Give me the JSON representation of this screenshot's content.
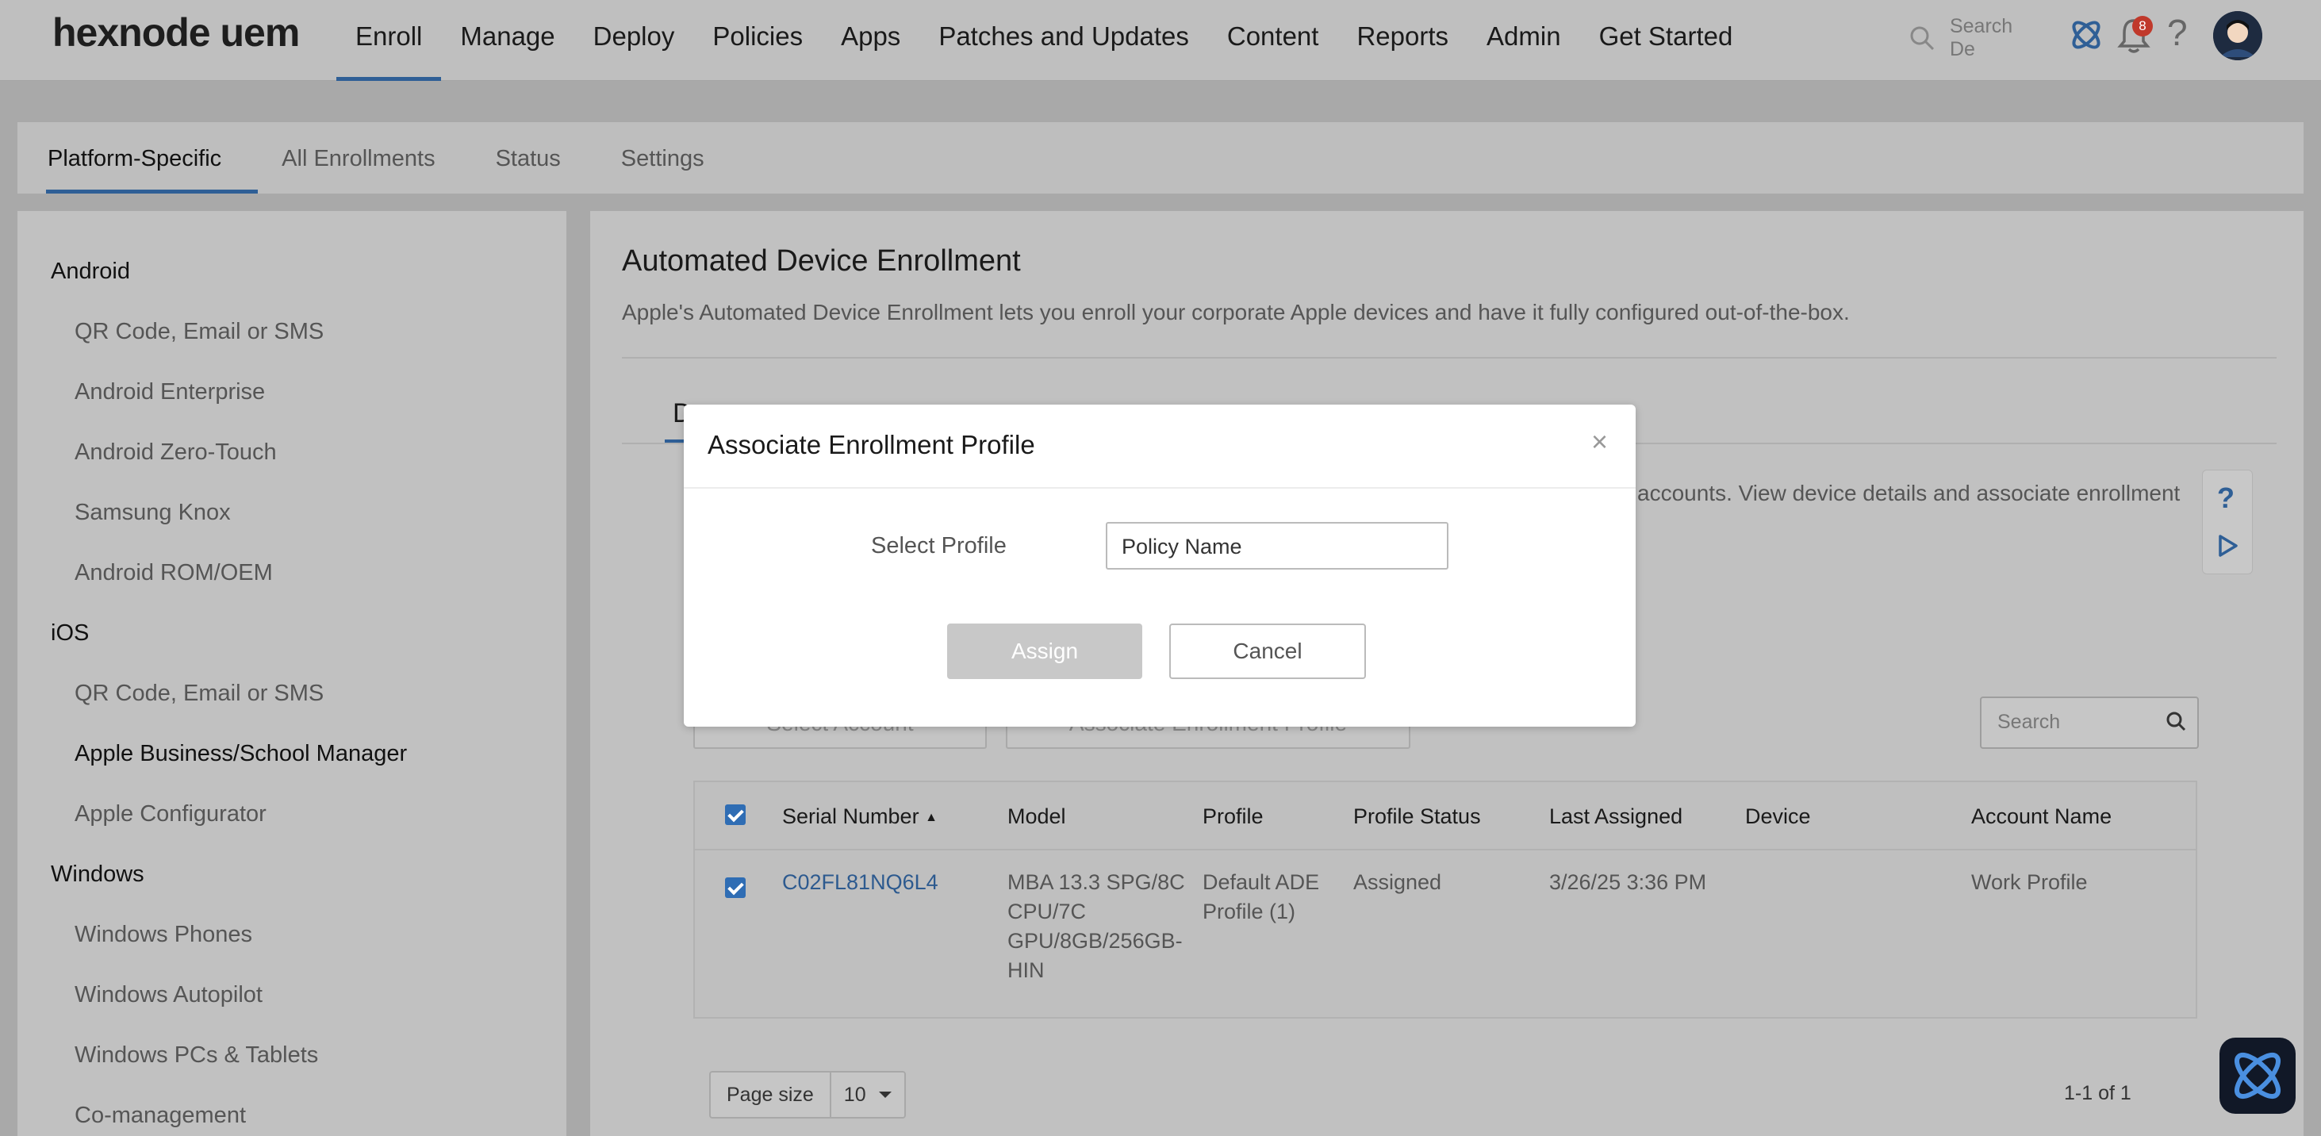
{
  "brand": {
    "logo": "hexnode uem"
  },
  "nav": {
    "items": [
      "Enroll",
      "Manage",
      "Deploy",
      "Policies",
      "Apps",
      "Patches and Updates",
      "Content",
      "Reports",
      "Admin",
      "Get Started"
    ],
    "active": "Enroll"
  },
  "topbar": {
    "search_placeholder": "Search De",
    "notification_count": "8",
    "help": "?"
  },
  "subtabs": [
    "Platform-Specific",
    "All Enrollments",
    "Status",
    "Settings"
  ],
  "sidebar": {
    "android": {
      "heading": "Android",
      "items": [
        "QR Code, Email or SMS",
        "Android Enterprise",
        "Android Zero-Touch",
        "Samsung Knox",
        "Android ROM/OEM"
      ]
    },
    "ios": {
      "heading": "iOS",
      "items": [
        "QR Code, Email or SMS",
        "Apple Business/School Manager",
        "Apple Configurator"
      ]
    },
    "windows": {
      "heading": "Windows",
      "items": [
        "Windows Phones",
        "Windows Autopilot",
        "Windows PCs & Tablets",
        "Co-management"
      ]
    }
  },
  "main": {
    "title": "Automated Device Enrollment",
    "description": "Apple's Automated Device Enrollment lets you enroll your corporate Apple devices and have it fully configured out-of-the-box.",
    "tab_partial": "D",
    "info_partial": "accounts. View device details and associate enrollment",
    "select_account_label": "Select Account",
    "associate_profile_label": "Associate Enrollment Profile",
    "search_placeholder": "Search"
  },
  "table": {
    "columns": [
      "Serial Number",
      "Model",
      "Profile",
      "Profile Status",
      "Last Assigned",
      "Device",
      "Account Name"
    ],
    "rows": [
      {
        "serial": "C02FL81NQ6L4",
        "model_lines": [
          "MBA 13.3 SPG/8C",
          "CPU/7C",
          "GPU/8GB/256GB-",
          "HIN"
        ],
        "profile_lines": [
          "Default ADE",
          "Profile (1)"
        ],
        "status": "Assigned",
        "last_assigned": "3/26/25 3:36 PM",
        "device": "",
        "account": "Work Profile"
      }
    ]
  },
  "pagination": {
    "page_size_label": "Page size",
    "page_size": "10",
    "range": "1-1 of 1"
  },
  "modal": {
    "title": "Associate Enrollment Profile",
    "close": "×",
    "select_label": "Select Profile",
    "select_value": "Policy Name",
    "assign": "Assign",
    "cancel": "Cancel"
  }
}
